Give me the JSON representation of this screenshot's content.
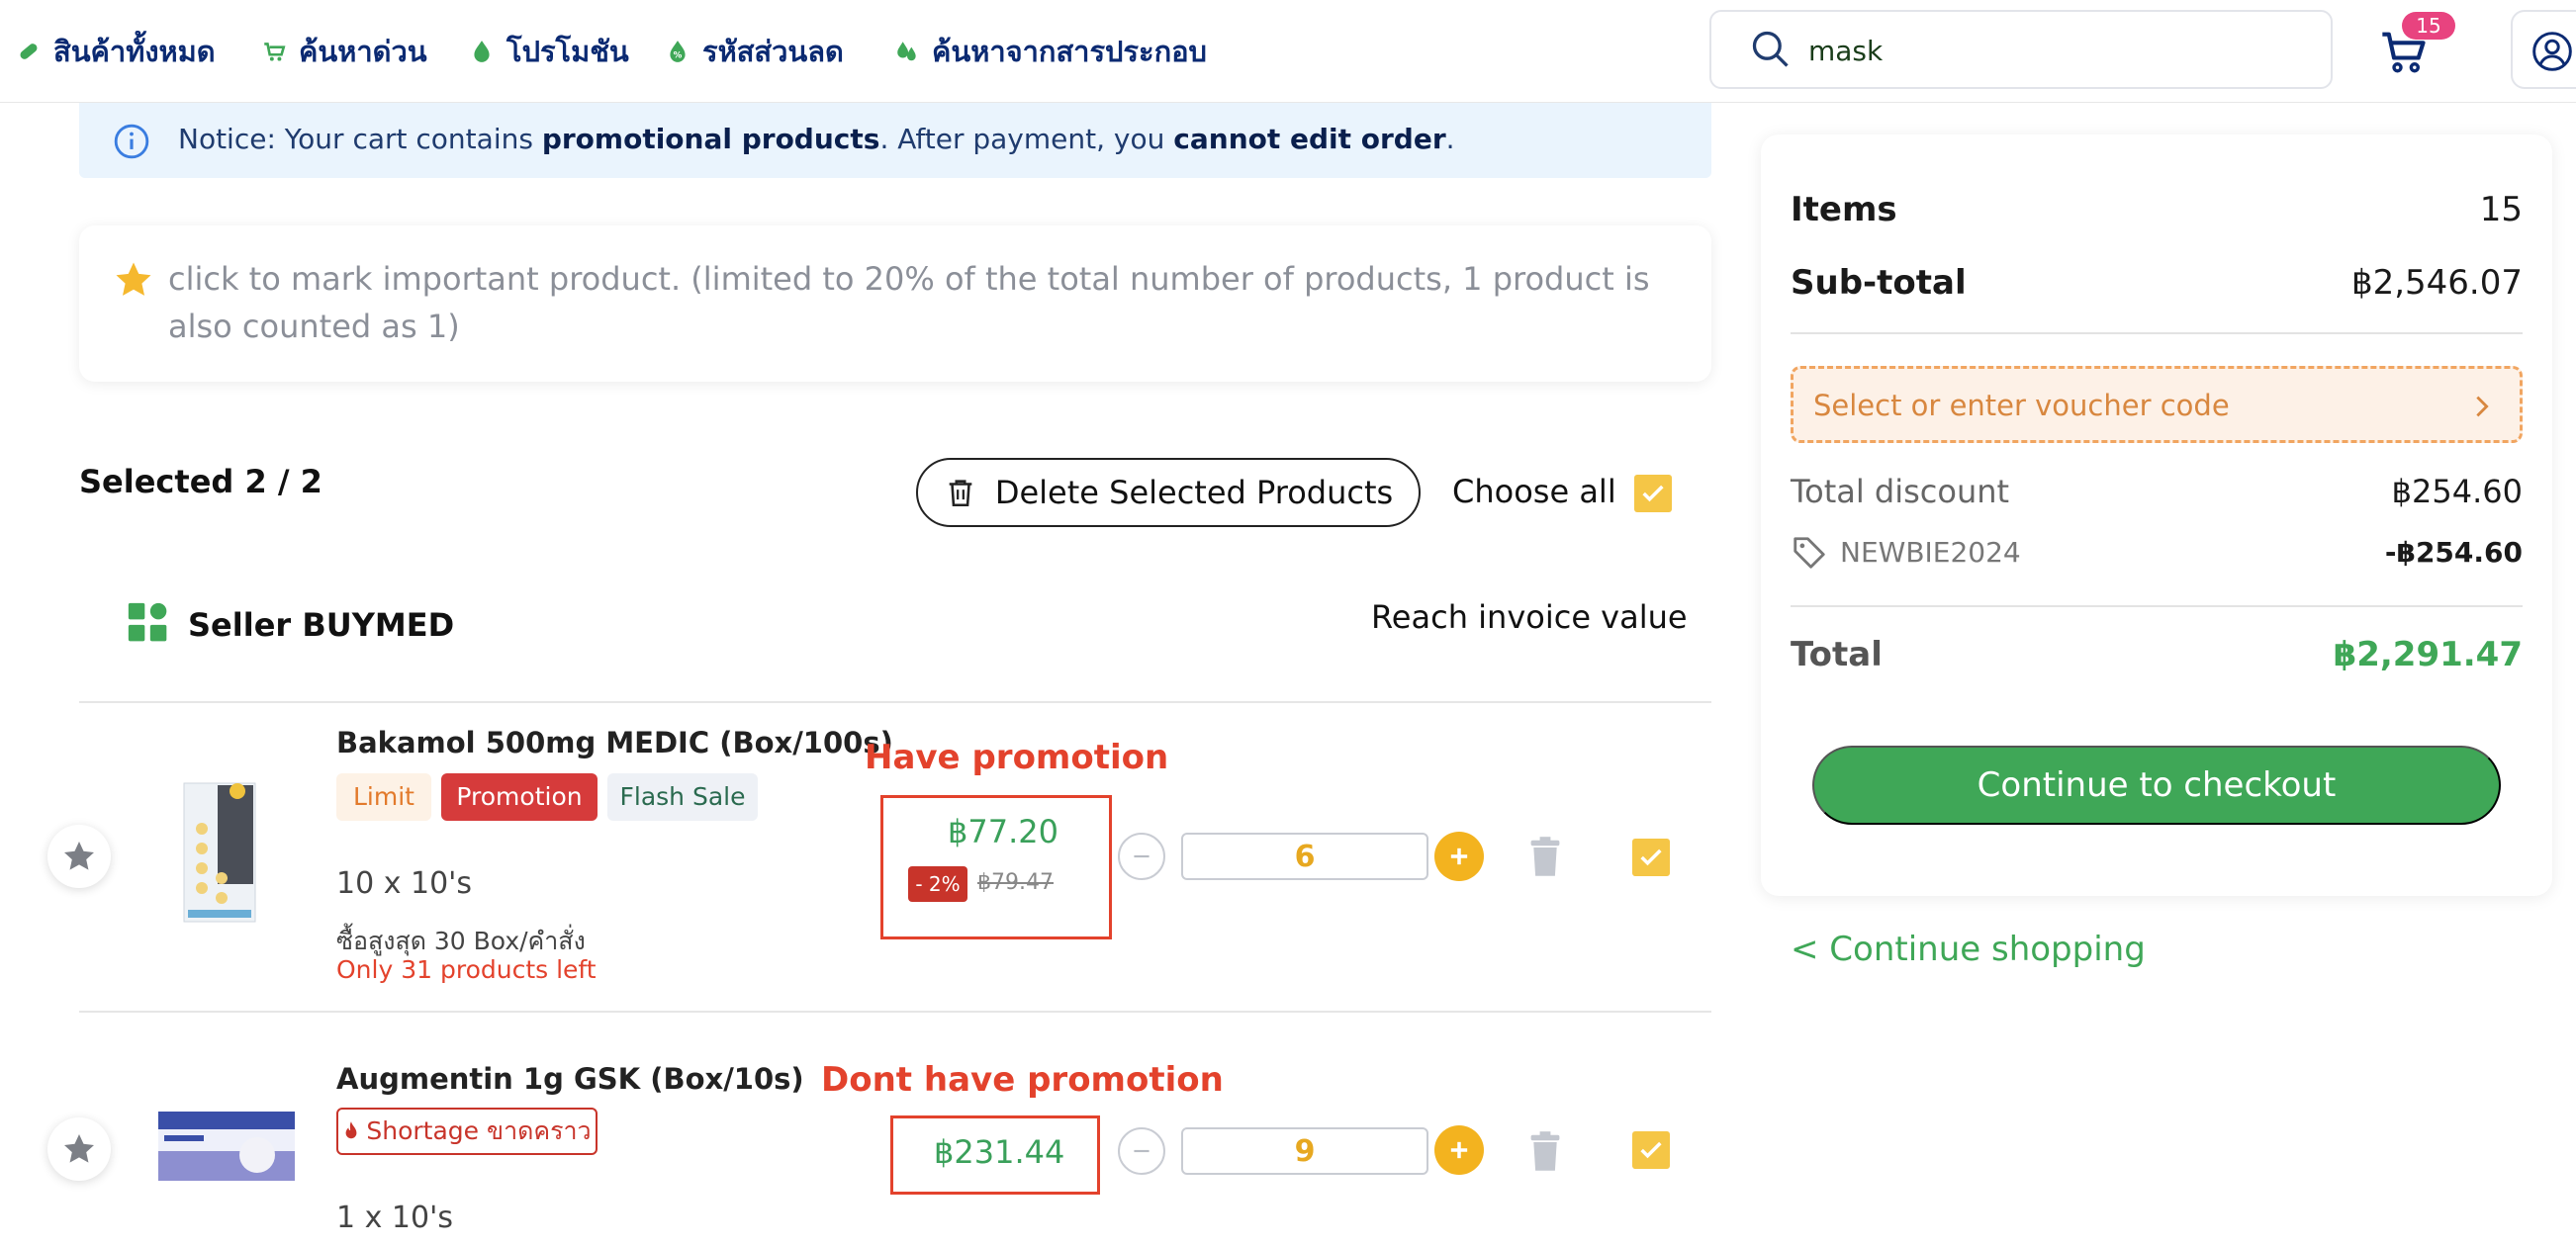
{
  "nav": {
    "items": [
      {
        "label": "สินค้าทั้งหมด"
      },
      {
        "label": "ค้นหาด่วน"
      },
      {
        "label": "โปรโมชัน"
      },
      {
        "label": "รหัสส่วนลด"
      },
      {
        "label": "ค้นหาจากสารประกอบ"
      }
    ],
    "search_value": "mask",
    "cart_count": "15"
  },
  "notice": {
    "prefix": "Notice: Your cart contains ",
    "bold1": "promotional products",
    "middle": ". After payment, you ",
    "bold2": "cannot edit order",
    "suffix": "."
  },
  "star_info": "click to mark important product. (limited to 20% of the total number of products, 1 product is also counted as 1)",
  "cart": {
    "selected": "Selected 2 / 2",
    "delete_label": "Delete Selected Products",
    "choose_all": "Choose all",
    "seller": "Seller BUYMED",
    "reach_invoice": "Reach invoice value"
  },
  "products": [
    {
      "name": "Bakamol 500mg MEDIC (Box/100s)",
      "tags": {
        "limit": "Limit",
        "promotion": "Promotion",
        "flash": "Flash Sale"
      },
      "pack": "10 x 10's",
      "max_order": "ซื้อสูงสุด 30 Box/คำสั่ง",
      "stock": "Only 31 products left",
      "annotation": "Have promotion",
      "price": "฿77.20",
      "discount": "- 2%",
      "old_price": "฿79.47",
      "qty": "6"
    },
    {
      "name": "Augmentin 1g GSK (Box/10s)",
      "tags": {
        "shortage": "Shortage ขาดคราว"
      },
      "pack": "1 x 10's",
      "annotation": "Dont have promotion",
      "price": "฿231.44",
      "qty": "9"
    }
  ],
  "summary": {
    "items_label": "Items",
    "items_value": "15",
    "subtotal_label": "Sub-total",
    "subtotal_value": "฿2,546.07",
    "voucher_label": "Select or enter voucher code",
    "discount_label": "Total discount",
    "discount_value": "฿254.60",
    "code": "NEWBIE2024",
    "code_value": "-฿254.60",
    "total_label": "Total",
    "total_value": "฿2,291.47",
    "checkout_label": "Continue to checkout",
    "continue_shopping": "< Continue shopping"
  },
  "colors": {
    "accent_green": "#3fa757",
    "nav_blue": "#0b2a72",
    "annotation_red": "#e3422c",
    "checkbox_yellow": "#f5c646"
  }
}
